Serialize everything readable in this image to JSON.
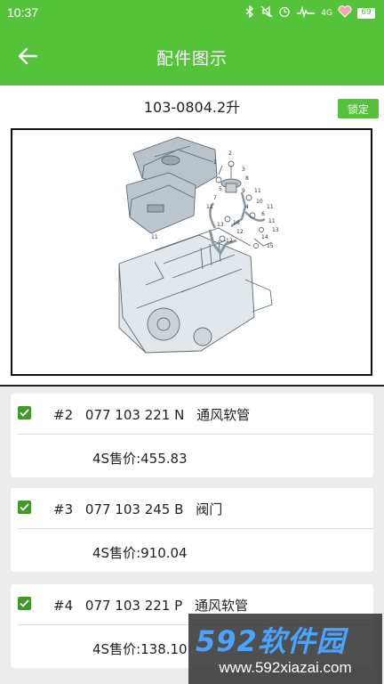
{
  "status_bar": {
    "time": "10:37",
    "network": "4G",
    "battery": "69",
    "icons": [
      "bluetooth-icon",
      "mute-icon",
      "alarm-icon",
      "wifi-icon",
      "signal-icon",
      "heart-icon",
      "battery-icon"
    ]
  },
  "header": {
    "title": "配件图示",
    "back_icon": "arrow-left-icon"
  },
  "subheader": {
    "code": "103-0804.2升",
    "lock_label": "锁定"
  },
  "diagram": {
    "callouts": [
      "1",
      "2",
      "3",
      "4",
      "5",
      "6",
      "7",
      "8",
      "9",
      "10",
      "11",
      "12",
      "13",
      "14",
      "15",
      "16"
    ]
  },
  "parts": [
    {
      "checked": true,
      "index": "#2",
      "number": "077 103 221 N",
      "name": "通风软管",
      "price": "4S售价:455.83"
    },
    {
      "checked": true,
      "index": "#3",
      "number": "077 103 245 B",
      "name": "阀门",
      "price": "4S售价:910.04"
    },
    {
      "checked": true,
      "index": "#4",
      "number": "077 103 221 P",
      "name": "通风软管",
      "price": "4S售价:138.10"
    }
  ],
  "watermark": {
    "brand": "592软件园",
    "url": "www.592xiazai.com"
  },
  "colors": {
    "accent": "#55c33a",
    "checkbox": "#3f9a2a",
    "background": "#ececec"
  }
}
